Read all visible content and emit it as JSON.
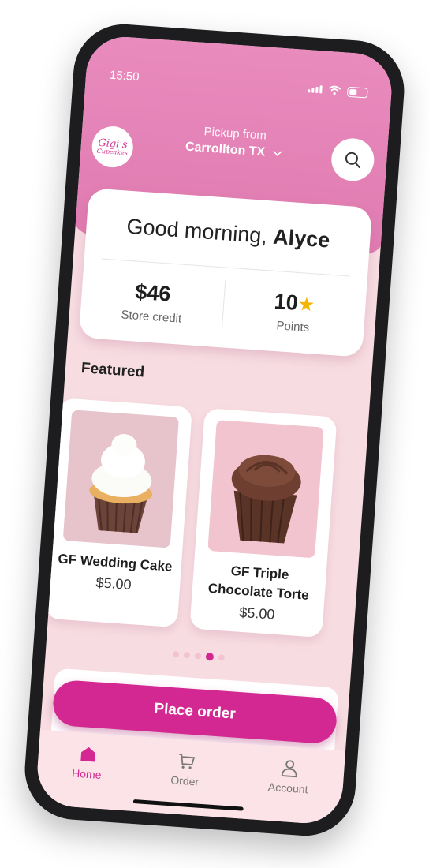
{
  "status_bar": {
    "time": "15:50"
  },
  "header": {
    "logo_line1": "Gigi's",
    "logo_line2": "Cupcakes",
    "pickup_label": "Pickup from",
    "pickup_location": "Carrollton TX",
    "accent_color": "#df7ab0"
  },
  "greeting": {
    "prefix": "Good morning,",
    "name": "Alyce"
  },
  "stats": {
    "store_credit_value": "$46",
    "store_credit_label": "Store credit",
    "points_value": "10",
    "points_label": "Points"
  },
  "featured": {
    "heading": "Featured",
    "items": [
      {
        "name": "GF Wedding Cake",
        "price": "$5.00",
        "icon": "vanilla-cupcake-image"
      },
      {
        "name": "GF Triple Chocolate Torte",
        "price": "$5.00",
        "icon": "chocolate-cupcake-image"
      }
    ],
    "carousel_active_index": 3,
    "carousel_count": 5
  },
  "cta": {
    "place_order_label": "Place order",
    "color": "#d32791"
  },
  "tabbar": {
    "items": [
      {
        "label": "Home",
        "icon": "home-icon",
        "active": true
      },
      {
        "label": "Order",
        "icon": "cart-icon",
        "active": false
      },
      {
        "label": "Account",
        "icon": "person-icon",
        "active": false
      }
    ]
  }
}
